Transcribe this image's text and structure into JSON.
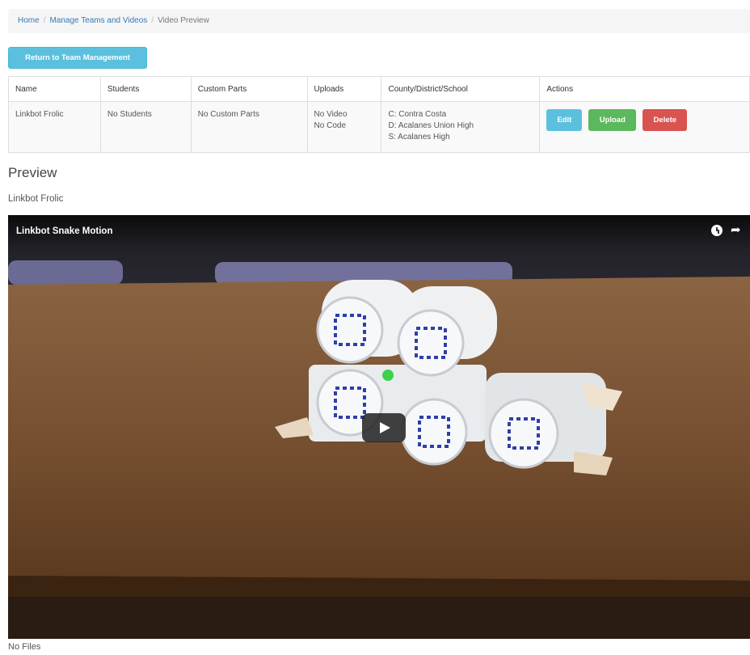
{
  "breadcrumb": {
    "home": "Home",
    "manage": "Manage Teams and Videos",
    "current": "Video Preview",
    "separator": "/"
  },
  "return_button": "Return to Team Management",
  "table": {
    "headers": {
      "name": "Name",
      "students": "Students",
      "custom_parts": "Custom Parts",
      "uploads": "Uploads",
      "county": "County/District/School",
      "actions": "Actions"
    },
    "row": {
      "name": "Linkbot Frolic",
      "students": "No Students",
      "custom_parts": "No Custom Parts",
      "uploads_video": "No Video",
      "uploads_code": "No Code",
      "county": "C: Contra Costa",
      "district": "D: Acalanes Union High",
      "school": "S: Acalanes High",
      "edit": "Edit",
      "upload": "Upload",
      "delete": "Delete"
    }
  },
  "preview": {
    "heading": "Preview",
    "title": "Linkbot Frolic",
    "video_name": "Linkbot Snake Motion"
  },
  "files": "No Files",
  "colors": {
    "info": "#5bc0de",
    "success": "#5cb85c",
    "danger": "#d9534f",
    "link": "#337ab7"
  },
  "icons": [
    "clock-icon",
    "share-icon",
    "play-icon"
  ]
}
